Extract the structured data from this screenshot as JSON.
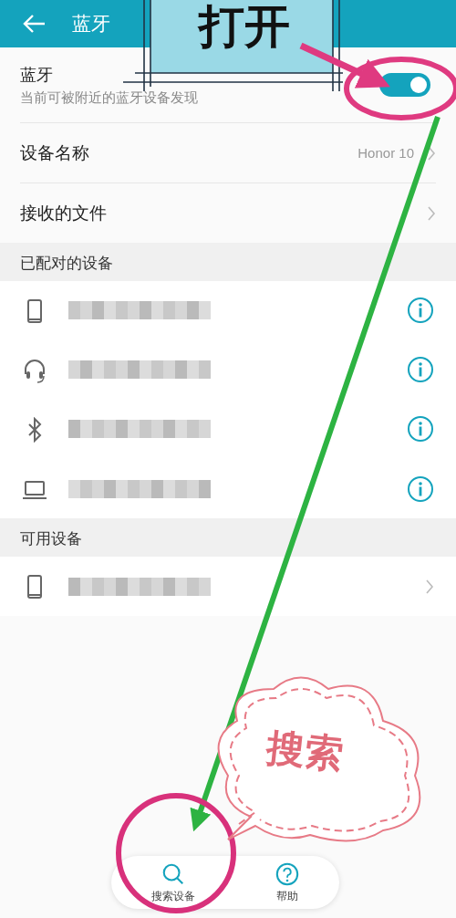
{
  "header": {
    "title": "蓝牙"
  },
  "bluetooth": {
    "label": "蓝牙",
    "subtitle": "当前可被附近的蓝牙设备发现",
    "on": true
  },
  "settings": [
    {
      "label": "设备名称",
      "value": "Honor 10"
    },
    {
      "label": "接收的文件"
    }
  ],
  "paired": {
    "heading": "已配对的设备",
    "devices": [
      {
        "kind": "phone"
      },
      {
        "kind": "headset"
      },
      {
        "kind": "bluetooth"
      },
      {
        "kind": "laptop"
      }
    ]
  },
  "available": {
    "heading": "可用设备",
    "devices": [
      {
        "kind": "phone"
      }
    ]
  },
  "bottom_bar": [
    {
      "kind": "search",
      "label": "搜索设备"
    },
    {
      "kind": "help",
      "label": "帮助"
    }
  ],
  "annotations": [
    {
      "kind": "label",
      "text": "打开"
    },
    {
      "kind": "callout",
      "text": "搜索"
    }
  ]
}
